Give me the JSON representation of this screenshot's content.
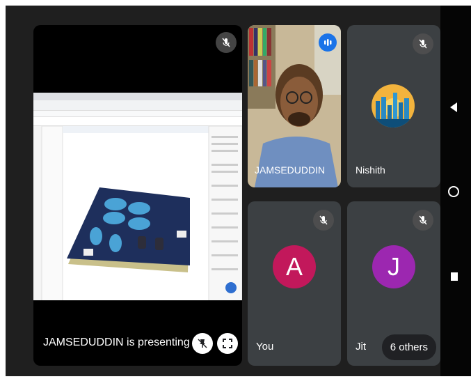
{
  "presenter_tile": {
    "caption": "JAMSEDUDDIN is presenting"
  },
  "participants": [
    {
      "name": "JAMSEDUDDIN"
    },
    {
      "name": "Nishith"
    },
    {
      "name": "You",
      "initial": "A",
      "color": "#c2185b"
    },
    {
      "name": "Jit",
      "initial": "J",
      "color": "#9c27b0"
    }
  ],
  "others_count_label": "6 others",
  "colors": {
    "tile_bg": "#3c4043",
    "speaking": "#1a73e8"
  },
  "icons": [
    "mic-off-icon",
    "speaking-icon",
    "pin-off-icon",
    "fullscreen-icon",
    "back-icon",
    "home-icon",
    "recents-icon"
  ]
}
